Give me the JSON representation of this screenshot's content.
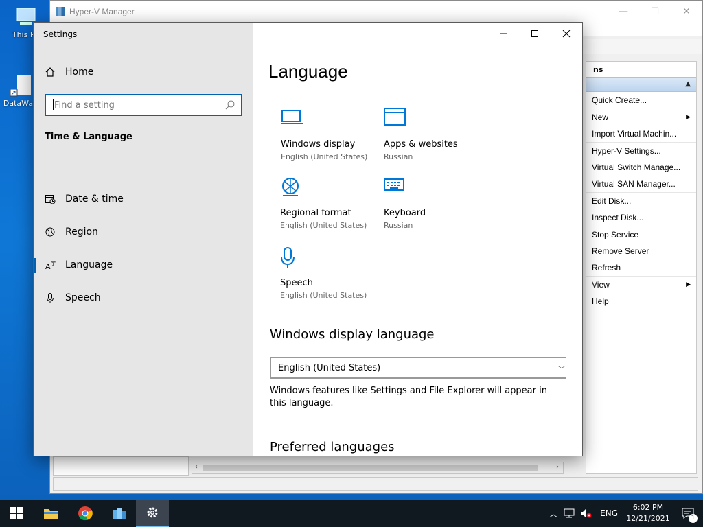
{
  "desktop": {
    "icons": [
      {
        "label": "This PC"
      },
      {
        "label": "DataWag"
      }
    ]
  },
  "hyperv": {
    "title": "Hyper-V Manager",
    "actions_header": "ns",
    "actions": [
      {
        "label": "Quick Create...",
        "submenu": false
      },
      {
        "label": "New",
        "submenu": true
      },
      {
        "label": "Import Virtual Machin...",
        "submenu": false
      },
      {
        "label": "Hyper-V Settings...",
        "submenu": false
      },
      {
        "label": "Virtual Switch Manage...",
        "submenu": false
      },
      {
        "label": "Virtual SAN Manager...",
        "submenu": false
      },
      {
        "label": "Edit Disk...",
        "submenu": false
      },
      {
        "label": "Inspect Disk...",
        "submenu": false
      },
      {
        "label": "Stop Service",
        "submenu": false
      },
      {
        "label": "Remove Server",
        "submenu": false
      },
      {
        "label": "Refresh",
        "submenu": false
      },
      {
        "label": "View",
        "submenu": true
      },
      {
        "label": "Help",
        "submenu": false
      }
    ]
  },
  "settings": {
    "window_title": "Settings",
    "home_label": "Home",
    "search_placeholder": "Find a setting",
    "section": "Time & Language",
    "nav": [
      {
        "label": "Date & time",
        "icon": "calendar-clock-icon",
        "active": false
      },
      {
        "label": "Region",
        "icon": "globe-icon",
        "active": false
      },
      {
        "label": "Language",
        "icon": "language-icon",
        "active": true
      },
      {
        "label": "Speech",
        "icon": "microphone-icon",
        "active": false
      }
    ],
    "page_title": "Language",
    "tiles": [
      {
        "name": "Windows display",
        "value": "English (United States)",
        "icon": "monitor-icon"
      },
      {
        "name": "Apps & websites",
        "value": "Russian",
        "icon": "browser-window-icon"
      },
      {
        "name": "Regional format",
        "value": "English (United States)",
        "icon": "regional-format-icon"
      },
      {
        "name": "Keyboard",
        "value": "Russian",
        "icon": "keyboard-icon"
      },
      {
        "name": "Speech",
        "value": "English (United States)",
        "icon": "microphone-icon"
      }
    ],
    "display_language_heading": "Windows display language",
    "display_language_value": "English (United States)",
    "display_language_desc": "Windows features like Settings and File Explorer will appear in this language.",
    "preferred_heading": "Preferred languages"
  },
  "taskbar": {
    "language": "ENG",
    "time": "6:02 PM",
    "date": "12/21/2021",
    "notification_count": "1"
  },
  "colors": {
    "accent": "#0063b1",
    "icon_blue": "#0078d7",
    "taskbar": "#101820"
  }
}
